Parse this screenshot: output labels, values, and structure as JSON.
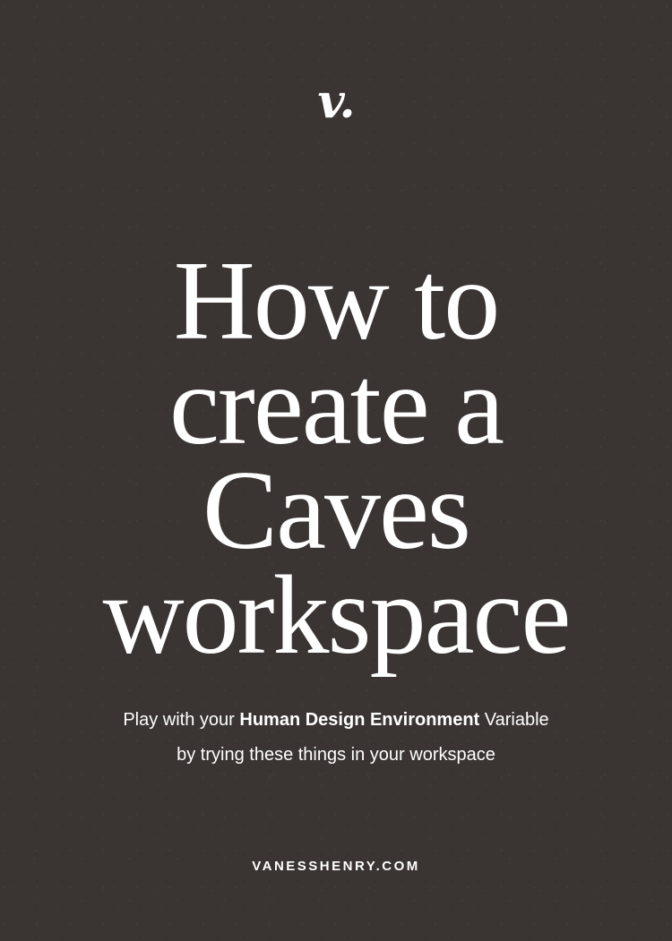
{
  "brand": {
    "logo": "v."
  },
  "title": {
    "lines": [
      "How to",
      "create a",
      "Caves",
      "workspace"
    ]
  },
  "subtitle": {
    "line1_prefix": "Play with your ",
    "line1_bold": "Human Design Environment",
    "line1_suffix": " Variable",
    "line2": "by trying these things in your workspace"
  },
  "footer": {
    "website": "VANESSHENRY.COM"
  },
  "colors": {
    "background": "#3a3432",
    "text": "#ffffff"
  }
}
